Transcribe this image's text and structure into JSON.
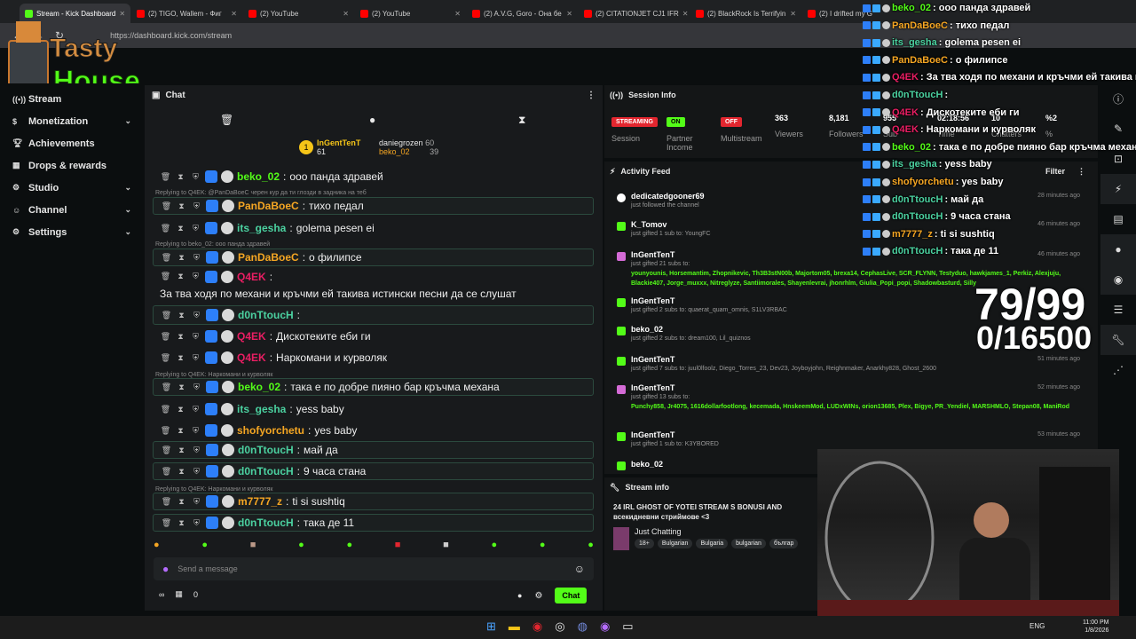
{
  "browser": {
    "tabs": [
      {
        "label": "Stream - Kick Dashboard",
        "color": "#53fc18",
        "active": true
      },
      {
        "label": "(2) TIGO, Wallem - Фиг",
        "color": "#ff0000"
      },
      {
        "label": "(2) YouTube",
        "color": "#ff0000"
      },
      {
        "label": "(2) YouTube",
        "color": "#ff0000"
      },
      {
        "label": "(2) A.V.G, Goro - Она бе",
        "color": "#ff0000"
      },
      {
        "label": "(2) CITATIONJET CJ1 IFR",
        "color": "#ff0000"
      },
      {
        "label": "(2) BlackRock Is Terrifyin",
        "color": "#ff0000"
      },
      {
        "label": "(2) I drifted my G",
        "color": "#ff0000"
      }
    ],
    "url": "https://dashboard.kick.com/stream"
  },
  "logo": {
    "line1": "Tasty",
    "line2": "House"
  },
  "nav": {
    "items": [
      {
        "label": "Stream",
        "icon": "broadcast-icon"
      },
      {
        "label": "Monetization",
        "icon": "dollar-icon"
      },
      {
        "label": "Achievements",
        "icon": "trophy-icon"
      },
      {
        "label": "Drops & rewards",
        "icon": "gift-icon"
      },
      {
        "label": "Studio",
        "icon": "gear-icon"
      },
      {
        "label": "Channel",
        "icon": "people-icon"
      },
      {
        "label": "Settings",
        "icon": "gear-icon"
      }
    ]
  },
  "chat": {
    "title": "Chat",
    "leaderboard": [
      {
        "name": "InGentTenT",
        "value": "61"
      },
      {
        "name": "daniegrozen",
        "value": "60"
      },
      {
        "name": "beko_02",
        "value": "39"
      }
    ],
    "messages": [
      {
        "reply": "",
        "user": "beko_02",
        "text": "ооо панда здравей",
        "color": "#53fc18"
      },
      {
        "reply": "Replying to Q4EK: @PanDaBoeC черен кур да ти глозди в задника на теб",
        "user": "PanDaBoeC",
        "text": "тихо педал",
        "color": "#f5a623"
      },
      {
        "reply": "",
        "user": "its_gesha",
        "text": "golema pesen ei",
        "color": "#4bd1a0"
      },
      {
        "reply": "Replying to beko_02: ооо панда здравей",
        "user": "PanDaBoeC",
        "text": "о филипсе",
        "color": "#f5a623"
      },
      {
        "reply": "",
        "user": "Q4EK",
        "text": "За тва ходя по механи и кръчми ей такива истински песни да се слушат",
        "color": "#e91e63"
      },
      {
        "reply": "",
        "user": "d0nTtoucH",
        "text": "",
        "color": "#4bd1a0"
      },
      {
        "reply": "",
        "user": "Q4EK",
        "text": "Дискотеките еби ги",
        "color": "#e91e63"
      },
      {
        "reply": "",
        "user": "Q4EK",
        "text": "Наркомани и курволяк",
        "color": "#e91e63"
      },
      {
        "reply": "Replying to Q4EK: Наркомани и курволяк",
        "user": "beko_02",
        "text": "така е по добре пияно бар кръчма механа",
        "color": "#53fc18"
      },
      {
        "reply": "",
        "user": "its_gesha",
        "text": "yess baby",
        "color": "#4bd1a0"
      },
      {
        "reply": "",
        "user": "shofyorchetu",
        "text": "yes baby",
        "color": "#f5a623"
      },
      {
        "reply": "",
        "user": "d0nTtoucH",
        "text": "май да",
        "color": "#4bd1a0"
      },
      {
        "reply": "",
        "user": "d0nTtoucH",
        "text": "9 часа стана",
        "color": "#4bd1a0"
      },
      {
        "reply": "Replying to Q4EK: Наркомани и курволяк",
        "user": "m7777_z",
        "text": "ti si sushtiq",
        "color": "#f5a623"
      },
      {
        "reply": "",
        "user": "d0nTtoucH",
        "text": "така де 11",
        "color": "#4bd1a0"
      }
    ],
    "input_placeholder": "Send a message",
    "footer_count": "0",
    "chat_button": "Chat"
  },
  "session": {
    "title": "Session Info",
    "stats": [
      {
        "value": "STREAMING",
        "label": "Session",
        "pill": "#e3262f"
      },
      {
        "value": "ON",
        "label": "Partner Income",
        "pill": "#53fc18"
      },
      {
        "value": "OFF",
        "label": "Multistream",
        "pill": "#e3262f"
      },
      {
        "value": "363",
        "label": "Viewers"
      },
      {
        "value": "8,181",
        "label": "Followers"
      },
      {
        "value": "955",
        "label": "Sub"
      },
      {
        "value": "02:18:56",
        "label": "Time"
      },
      {
        "value": "10",
        "label": "Chatters"
      },
      {
        "value": "%2",
        "label": "%"
      }
    ]
  },
  "activity": {
    "title": "Activity Feed",
    "filter_label": "Filter",
    "items": [
      {
        "user": "dedicatedgooner69",
        "desc": "just followed the channel",
        "time": "28 minutes ago",
        "recipients": ""
      },
      {
        "user": "K_Tomov",
        "desc": "just gifted 1 sub to: YoungFC",
        "time": "46 minutes ago",
        "recipients": ""
      },
      {
        "user": "InGentTenT",
        "desc": "just gifted 21 subs to:",
        "time": "46 minutes ago",
        "recipients": "younyounis, Horsemantim, Zhopnikevic, Th3B3stN00b, Majortom05, brexa14, CephasLive, SCR_FLYNN, Testyduo, hawkjames_1, Perkiz, Alexjuju, Blackie407, Jorge_muxxx, Nitreglyze, Santiimorales, Shayenlevrai, jhonrhlm, Giulia_Popi_popi, Shadowbasturd, Silly"
      },
      {
        "user": "InGentTenT",
        "desc": "just gifted 2 subs to: quaerat_quam_omnis, S1LV3RBAC",
        "time": "",
        "recipients": ""
      },
      {
        "user": "beko_02",
        "desc": "just gifted 2 subs to: dream100, Lil_quiznos",
        "time": "",
        "recipients": ""
      },
      {
        "user": "InGentTenT",
        "desc": "just gifted 7 subs to: juul0lfoolz, Diego_Torres_23, Dev23, Joyboyjohn, Reighnmaker, Anarkhy828, Ghost_2600",
        "time": "51 minutes ago",
        "recipients": ""
      },
      {
        "user": "InGentTenT",
        "desc": "just gifted 13 subs to:",
        "time": "52 minutes ago",
        "recipients": "Punchy858, Jr4075, 1616dollarfootlong, kecemada, HnskeemMod, LUDxWINs, orion13685, Plex, Bigye, PR_Yendiel, MARSHMLO, Stepan08, ManiRod"
      },
      {
        "user": "InGentTenT",
        "desc": "just gifted 1 sub to: K3YBORED",
        "time": "53 minutes ago",
        "recipients": ""
      },
      {
        "user": "beko_02",
        "desc": "",
        "time": "",
        "recipients": ""
      }
    ]
  },
  "stream_info": {
    "title": "Stream info",
    "stream_title": "24 IRL GHOST OF YOTEI STREAM S BONUSI AND всекидневни стриймове <3",
    "category": "Just Chatting",
    "tags": [
      "18+",
      "Bulgarian",
      "Bulgaria",
      "bulgarian",
      "българ"
    ]
  },
  "overlay": {
    "messages": [
      {
        "user": "beko_02",
        "text": ": ооо панда здравей",
        "color": "#53fc18"
      },
      {
        "user": "PanDaBoeC",
        "text": ": тихо педал",
        "color": "#f5a623"
      },
      {
        "user": "its_gesha",
        "text": ": golema pesen ei",
        "color": "#4bd1a0"
      },
      {
        "user": "PanDaBoeC",
        "text": ": о филипсе",
        "color": "#f5a623"
      },
      {
        "user": "Q4EK",
        "text": ": За тва ходя по механи и кръчми ей такива истинс",
        "color": "#e91e63"
      },
      {
        "user": "d0nTtoucH",
        "text": ":",
        "color": "#4bd1a0"
      },
      {
        "user": "Q4EK",
        "text": ": Дискотеките еби ги",
        "color": "#e91e63"
      },
      {
        "user": "Q4EK",
        "text": ": Наркомани и курволяк",
        "color": "#e91e63"
      },
      {
        "user": "beko_02",
        "text": ": така е по добре пияно бар кръчма механа",
        "color": "#53fc18"
      },
      {
        "user": "its_gesha",
        "text": ": yess baby",
        "color": "#4bd1a0"
      },
      {
        "user": "shofyorchetu",
        "text": ": yes baby",
        "color": "#f5a623"
      },
      {
        "user": "d0nTtoucH",
        "text": ": май да",
        "color": "#4bd1a0"
      },
      {
        "user": "d0nTtoucH",
        "text": ": 9 часа стана",
        "color": "#4bd1a0"
      },
      {
        "user": "m7777_z",
        "text": ": ti si sushtiq",
        "color": "#f5a623"
      },
      {
        "user": "d0nTtoucH",
        "text": ": така де 11",
        "color": "#4bd1a0"
      }
    ],
    "counter_main": "79/99",
    "counter_sub": "0/16500"
  },
  "taskbar": {
    "lang": "ENG",
    "time": "11:00 PM",
    "date": "1/8/2026"
  },
  "colors": {
    "accent": "#53fc18",
    "danger": "#e3262f"
  }
}
